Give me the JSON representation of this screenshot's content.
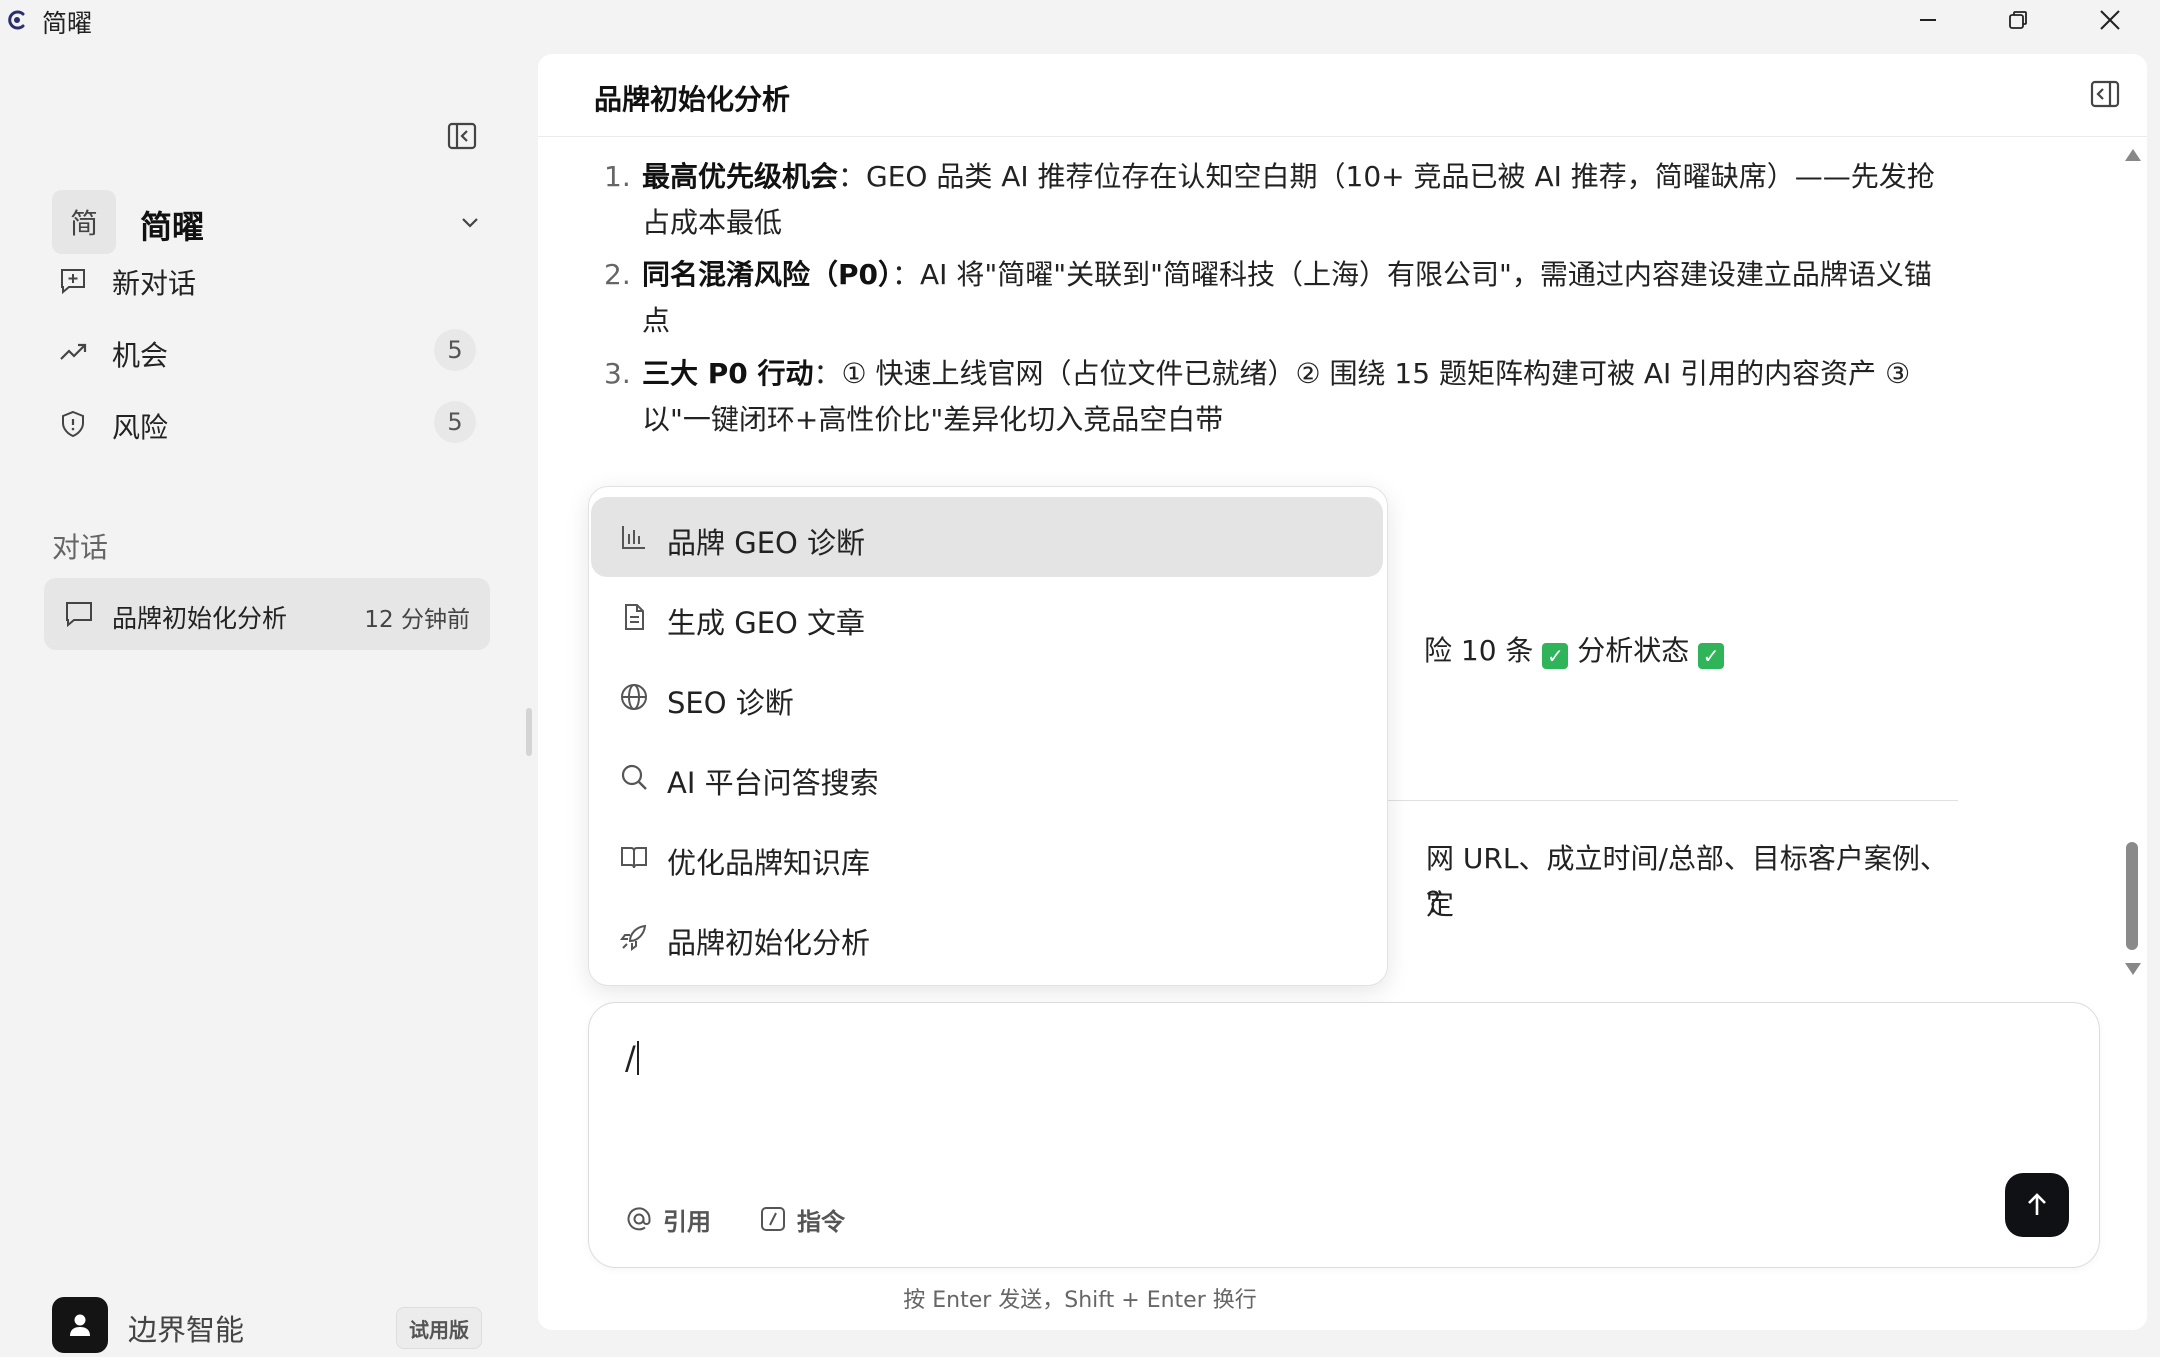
{
  "app": {
    "title": "简曜"
  },
  "sidebar": {
    "brand": {
      "avatar_text": "简",
      "name": "简曜"
    },
    "nav": [
      {
        "label": "新对话",
        "icon": "plus-square-icon"
      },
      {
        "label": "机会",
        "icon": "trending-up-icon",
        "count": "5"
      },
      {
        "label": "风险",
        "icon": "shield-icon",
        "count": "5"
      }
    ],
    "section_title": "对话",
    "conversations": [
      {
        "label": "品牌初始化分析",
        "time": "12 分钟前"
      }
    ],
    "user": {
      "name": "边界智能",
      "badge": "试用版"
    }
  },
  "main": {
    "title": "品牌初始化分析",
    "list": [
      {
        "num": "1.",
        "bold": "最高优先级机会",
        "text": "：GEO 品类 AI 推荐位存在认知空白期（10+ 竞品已被 AI 推荐，简曜缺席）——先发抢占成本最低"
      },
      {
        "num": "2.",
        "bold": "同名混淆风险（P0）",
        "text": "：AI 将\"简曜\"关联到\"简曜科技（上海）有限公司\"，需通过内容建设建立品牌语义锚点"
      },
      {
        "num": "3.",
        "bold": "三大 P0 行动",
        "text": "：① 快速上线官网（占位文件已就绪）② 围绕 15 题矩阵构建可被 AI 引用的内容资产 ③ 以\"一键闭环+高性价比\"差异化切入竞品空白带"
      }
    ],
    "partial_status_a": "险 10 条",
    "partial_status_b": "分析状态",
    "partial_line1": "网 URL、成立时间/总部、目标客户案例、定",
    "partial_line2": "？"
  },
  "slash_menu": {
    "items": [
      {
        "label": "品牌 GEO 诊断",
        "icon": "bar-chart-icon",
        "active": true
      },
      {
        "label": "生成 GEO 文章",
        "icon": "document-icon"
      },
      {
        "label": "SEO 诊断",
        "icon": "globe-icon"
      },
      {
        "label": "AI 平台问答搜索",
        "icon": "search-icon"
      },
      {
        "label": "优化品牌知识库",
        "icon": "book-icon"
      },
      {
        "label": "品牌初始化分析",
        "icon": "rocket-icon"
      }
    ]
  },
  "composer": {
    "value": "/",
    "mention_label": "引用",
    "command_label": "指令",
    "hint": "按 Enter 发送，Shift + Enter 换行"
  }
}
